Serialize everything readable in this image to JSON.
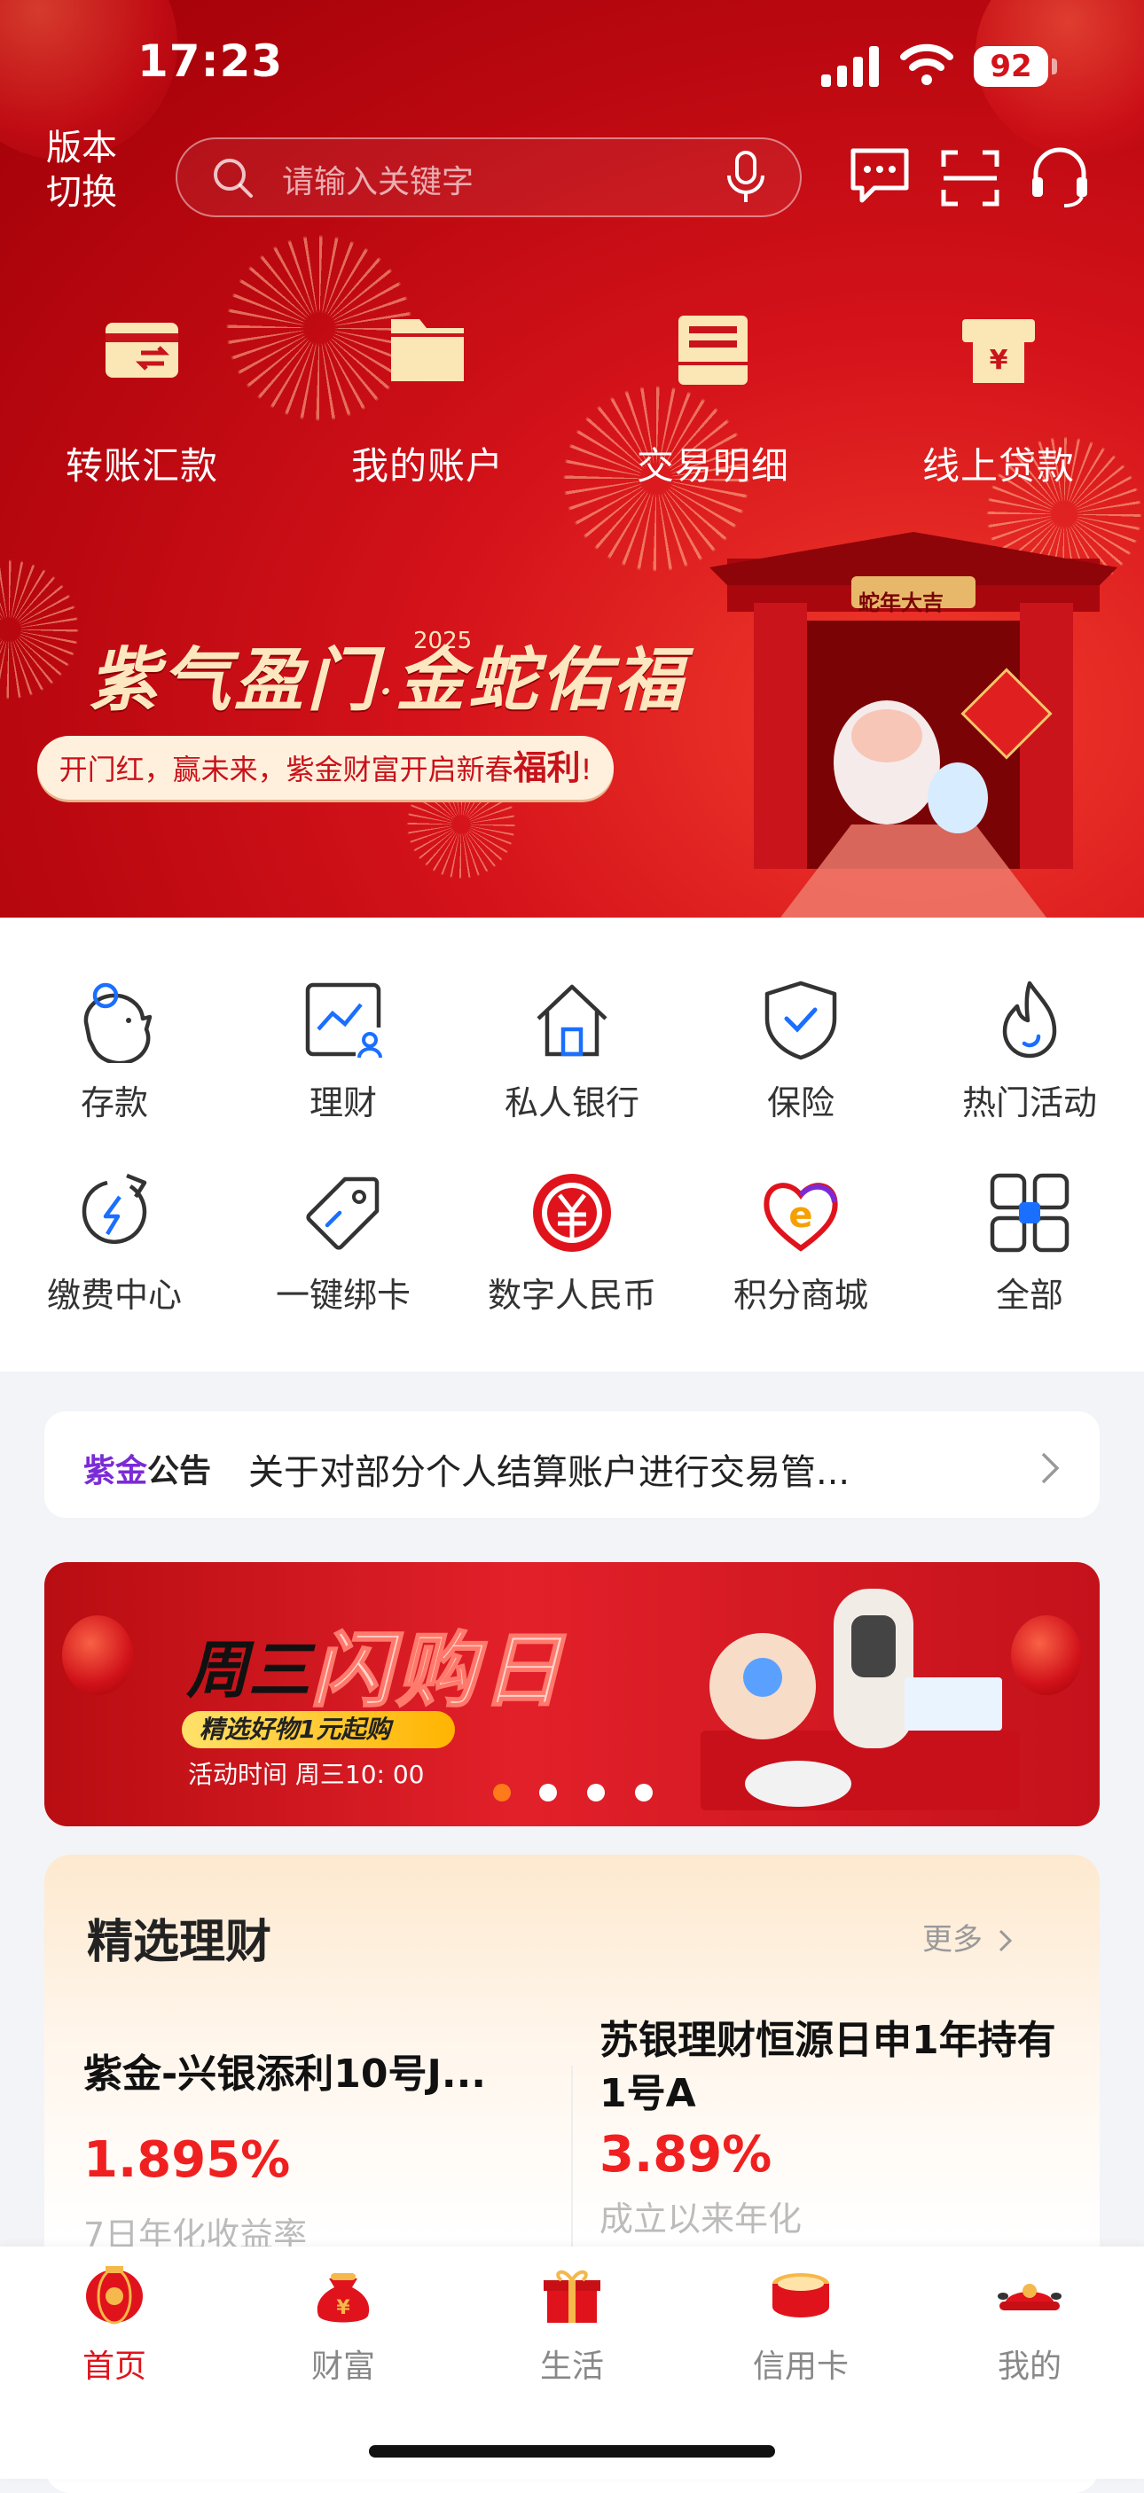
{
  "status_bar": {
    "time": "17:23",
    "battery": "92"
  },
  "header": {
    "version_switch": "版本\n切换",
    "search_placeholder": "请输入关键字"
  },
  "quick_actions": [
    {
      "label": "转账汇款",
      "icon": "transfer-icon"
    },
    {
      "label": "我的账户",
      "icon": "account-folder-icon"
    },
    {
      "label": "交易明细",
      "icon": "transaction-detail-icon"
    },
    {
      "label": "线上贷款",
      "icon": "loan-icon"
    }
  ],
  "hero_banner": {
    "slogan_left": "紫气盈门",
    "slogan_right": "金蛇佑福",
    "year": "2025",
    "gate_sign": "蛇年大吉",
    "pill_text": "开门红，赢未来，紫金财富开启新春",
    "pill_emphasis": "福利",
    "pill_end": "!"
  },
  "grid_items": [
    {
      "label": "存款",
      "icon": "piggy-bank-icon"
    },
    {
      "label": "理财",
      "icon": "wealth-chart-icon"
    },
    {
      "label": "私人银行",
      "icon": "private-bank-icon"
    },
    {
      "label": "保险",
      "icon": "shield-icon"
    },
    {
      "label": "热门活动",
      "icon": "flame-icon"
    },
    {
      "label": "缴费中心",
      "icon": "payment-icon"
    },
    {
      "label": "一键绑卡",
      "icon": "tag-icon"
    },
    {
      "label": "数字人民币",
      "icon": "ecny-icon"
    },
    {
      "label": "积分商城",
      "icon": "points-mall-icon"
    },
    {
      "label": "全部",
      "icon": "all-grid-icon"
    }
  ],
  "notice": {
    "tag_brand": "紫金",
    "tag_text": "公告",
    "text": "关于对部分个人结算账户进行交易管..."
  },
  "promo": {
    "title_left": "周三",
    "title_right": "闪购日",
    "subtitle": "精选好物1元起购",
    "time": "活动时间  周三10: 00",
    "dots": 4,
    "active_dot": 0
  },
  "wealth": {
    "title": "精选理财",
    "more": "更多",
    "products": [
      {
        "name": "紫金-兴银添利10号J...",
        "rate": "1.895%",
        "desc": "7日年化收益率"
      },
      {
        "name": "苏银理财恒源日申1年持有1号A",
        "rate": "3.89%",
        "desc": "成立以来年化"
      }
    ]
  },
  "tabs": [
    {
      "label": "首页",
      "active": true
    },
    {
      "label": "财富",
      "active": false
    },
    {
      "label": "生活",
      "active": false
    },
    {
      "label": "信用卡",
      "active": false
    },
    {
      "label": "我的",
      "active": false
    }
  ],
  "colors": {
    "brand_red": "#d4121a",
    "icon_blue": "#1a6fff",
    "rate_red": "#f02020"
  }
}
